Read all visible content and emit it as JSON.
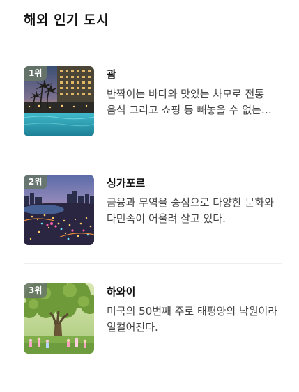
{
  "section": {
    "title": "해외 인기 도시"
  },
  "cities": [
    {
      "rank": "1위",
      "name": "괌",
      "description": "반짝이는 바다와 맛있는 차모로 전통 음식 그리고 쇼핑 등 빼놓을 수 없는 즐길거리가 가득하다.",
      "image_icon": "guam-beach-resort-photo"
    },
    {
      "rank": "2위",
      "name": "싱가포르",
      "description": "금융과 무역을 중심으로 다양한 문화와 다민족이 어울려 살고 있다.",
      "image_icon": "singapore-night-skyline-photo"
    },
    {
      "rank": "3위",
      "name": "하와이",
      "description": "미국의 50번째 주로 태평양의 낙원이라 일컬어진다.",
      "image_icon": "hawaii-big-tree-photo"
    }
  ],
  "colors": {
    "badge_background": "#687668",
    "title_text": "#111111",
    "description_text": "#444444",
    "divider": "#eeeeee"
  }
}
